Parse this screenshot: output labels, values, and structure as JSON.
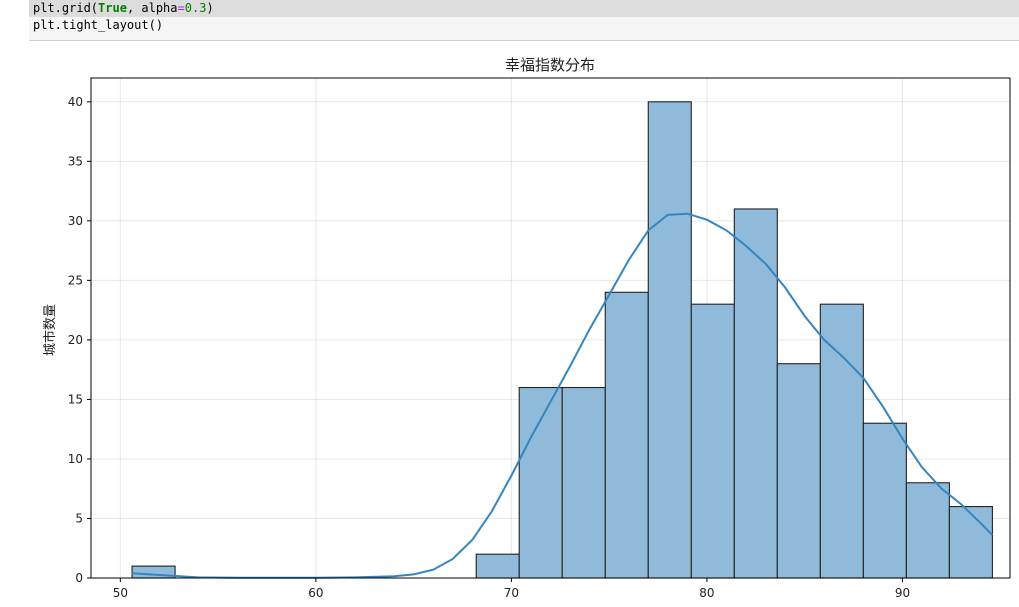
{
  "code": {
    "line1": {
      "pre": "plt.grid(",
      "kw": "True",
      "mid": ", alpha",
      "op": "=",
      "num": "0.3",
      "post": ")"
    },
    "line2": "plt.tight_layout()"
  },
  "chart_data": {
    "type": "bar",
    "title": "幸福指数分布",
    "xlabel": "",
    "ylabel": "城市数量",
    "xlim": [
      48.5,
      95.5
    ],
    "ylim": [
      0,
      42
    ],
    "xticks": [
      50,
      60,
      70,
      80,
      90
    ],
    "yticks": [
      0,
      5,
      10,
      15,
      20,
      25,
      30,
      35,
      40
    ],
    "grid": true,
    "bar_color": "#8fbada",
    "edge_color": "#222222",
    "kde_color": "#3585c0",
    "bins": [
      {
        "x0": 50.6,
        "x1": 52.8,
        "count": 1
      },
      {
        "x0": 68.2,
        "x1": 70.4,
        "count": 2
      },
      {
        "x0": 70.4,
        "x1": 72.6,
        "count": 16
      },
      {
        "x0": 72.6,
        "x1": 74.8,
        "count": 16
      },
      {
        "x0": 74.8,
        "x1": 77.0,
        "count": 24
      },
      {
        "x0": 77.0,
        "x1": 79.2,
        "count": 40
      },
      {
        "x0": 79.2,
        "x1": 81.4,
        "count": 23
      },
      {
        "x0": 81.4,
        "x1": 83.6,
        "count": 31
      },
      {
        "x0": 83.6,
        "x1": 85.8,
        "count": 18
      },
      {
        "x0": 85.8,
        "x1": 88.0,
        "count": 23
      },
      {
        "x0": 88.0,
        "x1": 90.2,
        "count": 13
      },
      {
        "x0": 90.2,
        "x1": 92.4,
        "count": 8
      },
      {
        "x0": 92.4,
        "x1": 94.6,
        "count": 6
      }
    ],
    "kde": {
      "x": [
        50.6,
        52,
        54,
        56,
        58,
        60,
        62,
        64,
        65,
        66,
        67,
        68,
        69,
        70,
        71,
        72,
        73,
        74,
        75,
        76,
        77,
        78,
        79,
        80,
        81,
        82,
        83,
        84,
        85,
        86,
        87,
        88,
        89,
        90,
        91,
        92,
        93,
        94,
        94.6
      ],
      "y": [
        0.4,
        0.25,
        0.05,
        0.02,
        0.02,
        0.02,
        0.05,
        0.15,
        0.3,
        0.7,
        1.6,
        3.2,
        5.6,
        8.6,
        11.8,
        14.8,
        17.8,
        20.9,
        23.8,
        26.7,
        29.2,
        30.5,
        30.6,
        30.1,
        29.2,
        27.9,
        26.4,
        24.4,
        22.0,
        20.0,
        18.5,
        16.8,
        14.4,
        11.7,
        9.3,
        7.5,
        6.2,
        4.6,
        3.6
      ]
    }
  }
}
